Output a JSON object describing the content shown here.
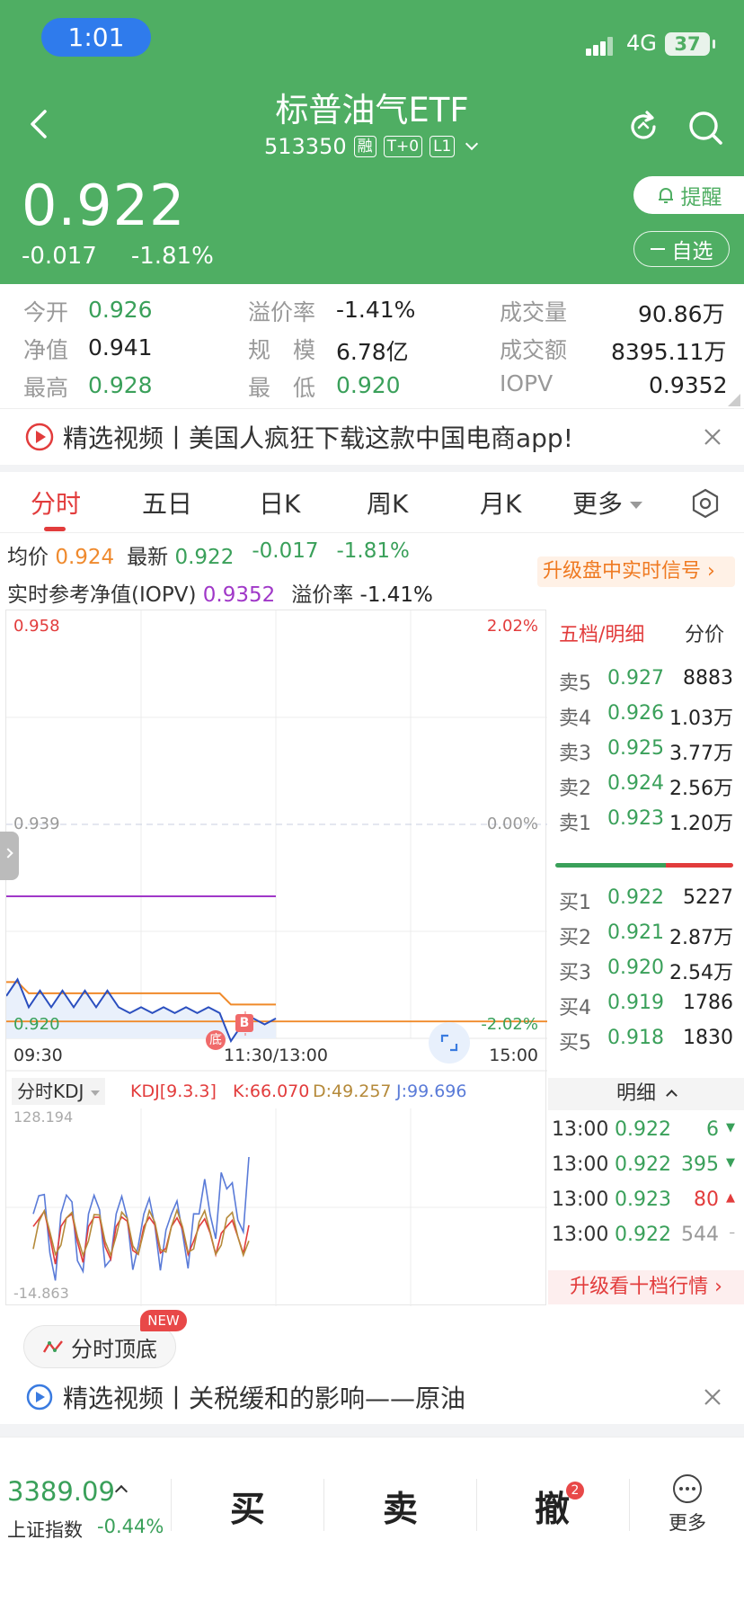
{
  "status_bar": {
    "time": "1:01",
    "network": "4G",
    "battery": "37"
  },
  "header": {
    "title": "标普油气ETF",
    "code": "513350",
    "tags": [
      "融",
      "T+0",
      "L1"
    ],
    "price": "0.922",
    "change": "-0.017",
    "change_pct": "-1.81%",
    "remind_label": "提醒",
    "fav_label": "自选"
  },
  "stats": {
    "open_label": "今开",
    "open": "0.926",
    "premium_label": "溢价率",
    "premium": "-1.41%",
    "volume_label": "成交量",
    "volume": "90.86万",
    "nav_label": "净值",
    "nav": "0.941",
    "scale_label": "规　模",
    "scale": "6.78亿",
    "amount_label": "成交额",
    "amount": "8395.11万",
    "high_label": "最高",
    "high": "0.928",
    "low_label": "最　低",
    "low": "0.920",
    "iopv_label": "IOPV",
    "iopv": "0.9352"
  },
  "promo1": "精选视频丨美国人疯狂下载这款中国电商app!",
  "tabs": [
    "分时",
    "五日",
    "日K",
    "周K",
    "月K",
    "更多"
  ],
  "info": {
    "avg_label": "均价",
    "avg": "0.924",
    "latest_label": "最新",
    "latest": "0.922",
    "chg": "-0.017",
    "chg_pct": "-1.81%",
    "iopv_label": "实时参考净值(IOPV)",
    "iopv": "0.9352",
    "prem_label": "溢价率",
    "prem": "-1.41%",
    "upgrade": "升级盘中实时信号"
  },
  "chart": {
    "y_top": "0.958",
    "y_mid": "0.939",
    "y_bot": "0.920",
    "pct_top": "2.02%",
    "pct_mid": "0.00%",
    "pct_bot": "-2.02%",
    "x_start": "09:30",
    "x_mid": "11:30/13:00",
    "x_end": "15:00",
    "marker_bottom": "底",
    "marker_b": "B",
    "kdj_selector": "分时KDJ",
    "kdj_params": "KDJ[9.3.3]",
    "kdj_k": "K:66.070",
    "kdj_d": "D:49.257",
    "kdj_j": "J:99.696",
    "kdj_top": "128.194",
    "kdj_bot": "-14.863"
  },
  "chart_data": {
    "type": "line",
    "title": "",
    "x_range": [
      "09:30",
      "15:00"
    ],
    "ylim": [
      0.92,
      0.958
    ],
    "prev_close": 0.939,
    "series": [
      {
        "name": "",
        "values": [
          0.924,
          0.925,
          0.923,
          0.924,
          0.923,
          0.924,
          0.923,
          0.924,
          0.923,
          0.924,
          0.923,
          0.922,
          0.923,
          0.922,
          0.923,
          0.922,
          0.923,
          0.922,
          0.923,
          0.922,
          0.92,
          0.921,
          0.922,
          0.921,
          0.922
        ]
      },
      {
        "name": "",
        "values": [
          0.925,
          0.925,
          0.924,
          0.924,
          0.924,
          0.924,
          0.924,
          0.924,
          0.924,
          0.924,
          0.924,
          0.924,
          0.924,
          0.924,
          0.924,
          0.924,
          0.924,
          0.924,
          0.924,
          0.924,
          0.923,
          0.923,
          0.923,
          0.923,
          0.923
        ]
      },
      {
        "name": "IOPV",
        "values": [
          0.9352,
          0.9352
        ]
      }
    ],
    "kdj": {
      "ylim": [
        -14.863,
        128.194
      ],
      "k": 66.07,
      "d": 49.257,
      "j": 99.696
    }
  },
  "orderbook": {
    "title": "五档/明细",
    "title2": "分价",
    "sells": [
      {
        "label": "卖5",
        "price": "0.927",
        "vol": "8883"
      },
      {
        "label": "卖4",
        "price": "0.926",
        "vol": "1.03万"
      },
      {
        "label": "卖3",
        "price": "0.925",
        "vol": "3.77万"
      },
      {
        "label": "卖2",
        "price": "0.924",
        "vol": "2.56万"
      },
      {
        "label": "卖1",
        "price": "0.923",
        "vol": "1.20万"
      }
    ],
    "buys": [
      {
        "label": "买1",
        "price": "0.922",
        "vol": "5227"
      },
      {
        "label": "买2",
        "price": "0.921",
        "vol": "2.87万"
      },
      {
        "label": "买3",
        "price": "0.920",
        "vol": "2.54万"
      },
      {
        "label": "买4",
        "price": "0.919",
        "vol": "1786"
      },
      {
        "label": "买5",
        "price": "0.918",
        "vol": "1830"
      }
    ],
    "detail_label": "明细",
    "trades": [
      {
        "time": "13:00",
        "price": "0.922",
        "vol": "6",
        "dir": "down"
      },
      {
        "time": "13:00",
        "price": "0.922",
        "vol": "395",
        "dir": "down"
      },
      {
        "time": "13:00",
        "price": "0.923",
        "vol": "80",
        "dir": "up"
      },
      {
        "time": "13:00",
        "price": "0.922",
        "vol": "544",
        "dir": "flat"
      }
    ],
    "upgrade": "升级看十档行情"
  },
  "feature": {
    "label": "分时顶底",
    "badge": "NEW"
  },
  "promo2": "精选视频丨关税缓和的影响——原油",
  "bottom": {
    "index_value": "3389.09",
    "index_name": "上证指数",
    "index_chg": "-0.44%",
    "buy": "买",
    "sell": "卖",
    "cancel": "撤",
    "cancel_badge": "2",
    "more": "更多"
  }
}
